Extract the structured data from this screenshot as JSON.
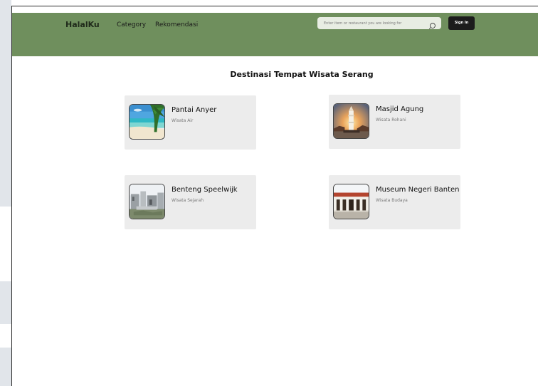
{
  "navbar": {
    "brand": "HalalKu",
    "links": [
      "Category",
      "Rekomendasi"
    ],
    "search": {
      "placeholder": "Enter item or restaurant you are looking for",
      "value": ""
    },
    "signin_label": "Sign In",
    "background_color": "#6f8f5d"
  },
  "main": {
    "title": "Destinasi Tempat Wisata Serang",
    "cards": [
      {
        "title": "Pantai Anyer",
        "subtitle": "Wisata Air",
        "image": "beach-photo"
      },
      {
        "title": "Masjid Agung",
        "subtitle": "Wisata Rohani",
        "image": "mosque-photo"
      },
      {
        "title": "Benteng Speelwijk",
        "subtitle": "Wisata Sejarah",
        "image": "fort-ruins-photo"
      },
      {
        "title": "Museum Negeri Banten",
        "subtitle": "Wisata Budaya",
        "image": "museum-photo"
      }
    ]
  }
}
